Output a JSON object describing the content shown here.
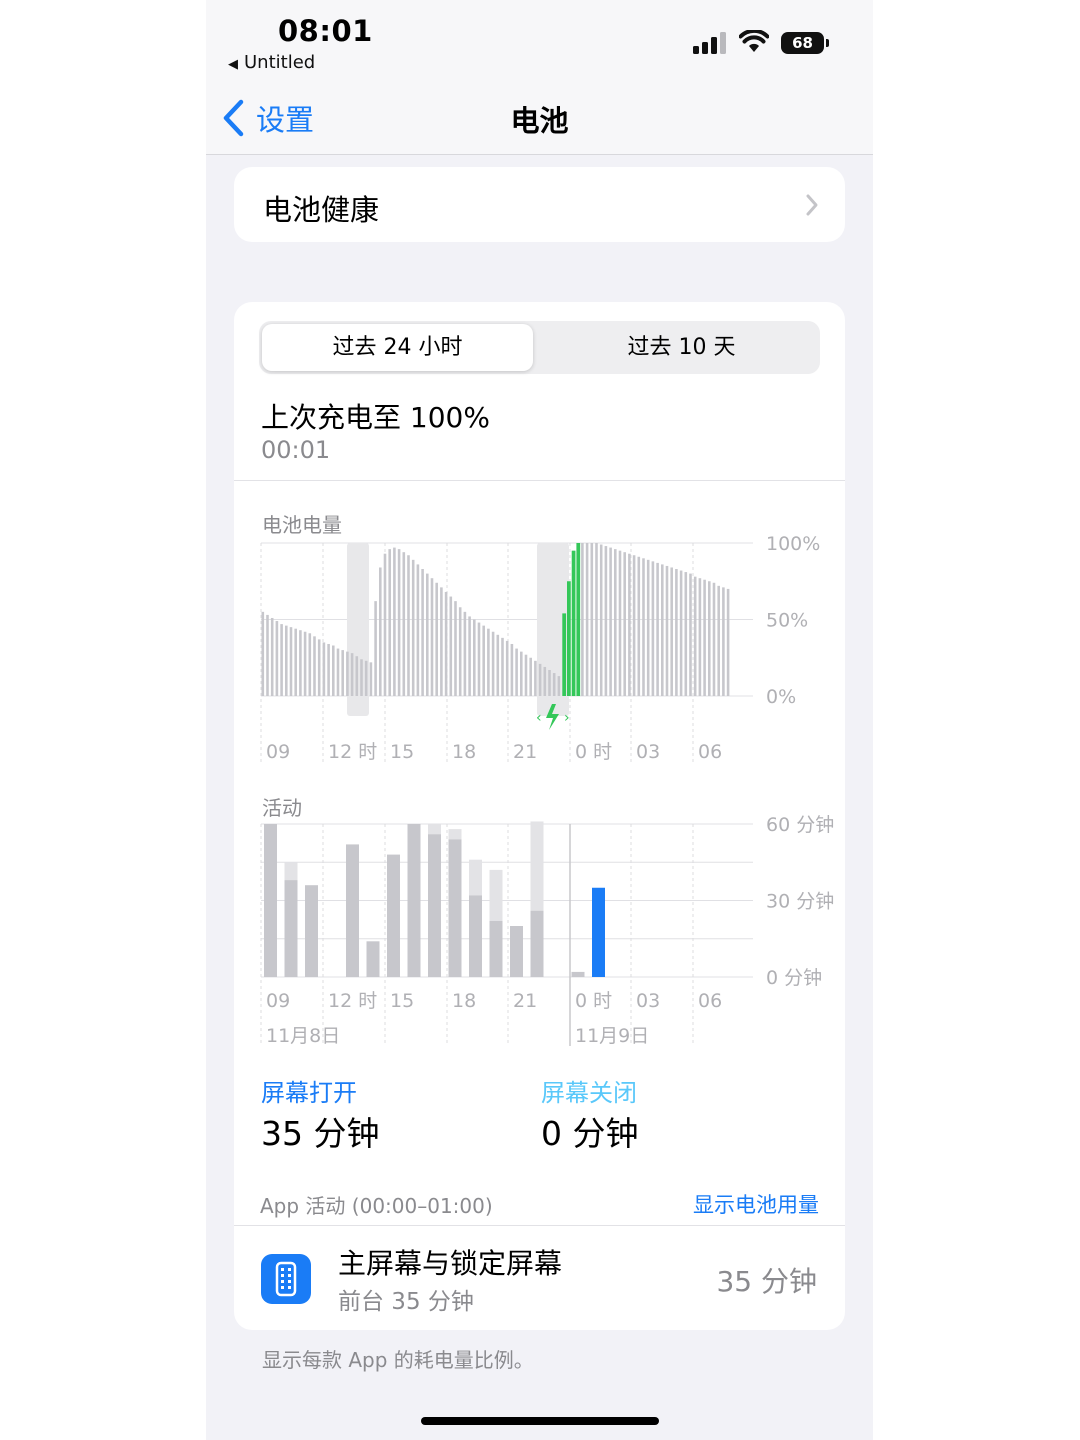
{
  "status_bar": {
    "time": "08:01",
    "back_app": "Untitled",
    "battery_level": "68"
  },
  "nav": {
    "back_label": "设置",
    "title": "电池"
  },
  "battery_health": {
    "label": "电池健康"
  },
  "segments": {
    "active": "过去 24 小时",
    "idle": "过去 10 天"
  },
  "last_charge": {
    "label": "上次充电至 100%",
    "time": "00:01"
  },
  "battery_chart_label": "电池电量",
  "activity_chart_label": "活动",
  "screen_on": {
    "label": "屏幕打开",
    "value": "35 分钟"
  },
  "screen_off": {
    "label": "屏幕关闭",
    "value": "0 分钟"
  },
  "app_activity": {
    "header": "App 活动 (00:00–01:00)",
    "show_usage": "显示电池用量",
    "row": {
      "name": "主屏幕与锁定屏幕",
      "sub": "前台 35 分钟",
      "time": "35 分钟"
    }
  },
  "footnote": "显示每款 App 的耗电量比例。",
  "colors": {
    "accent": "#1a7cf6",
    "charging_green": "#34c759",
    "bar_gray": "#c7c7cc",
    "bar_light": "#e3e3e6"
  },
  "chart_data": [
    {
      "type": "bar",
      "title": "电池电量",
      "x_tick_labels": [
        "09",
        "12 时",
        "15",
        "18",
        "21",
        "0 时",
        "03",
        "06"
      ],
      "y_tick_labels": [
        "100%",
        "50%",
        "0%"
      ],
      "ylim": [
        0,
        100
      ],
      "battery_percent": [
        55,
        53,
        51,
        49,
        47,
        46,
        45,
        44,
        43,
        42,
        41,
        39,
        37,
        35,
        34,
        33,
        31,
        30,
        29,
        28,
        26,
        24,
        23,
        22,
        62,
        84,
        93,
        96,
        97,
        96,
        94,
        92,
        89,
        86,
        83,
        80,
        77,
        74,
        71,
        68,
        65,
        62,
        58,
        55,
        52,
        50,
        48,
        46,
        44,
        42,
        40,
        38,
        36,
        34,
        31,
        29,
        27,
        25,
        23,
        21,
        19,
        17,
        15,
        13,
        54,
        75,
        95,
        100,
        100,
        100,
        100,
        100,
        99,
        98,
        97,
        96,
        95,
        94,
        93,
        92,
        91,
        90,
        89,
        88,
        87,
        86,
        85,
        84,
        83,
        82,
        81,
        80,
        78,
        77,
        76,
        75,
        74,
        72,
        71,
        70
      ],
      "charging_ranges": [
        "12 时",
        "23–0 时"
      ],
      "full_charge_highlight": "0 时",
      "grid": true
    },
    {
      "type": "bar",
      "title": "活动",
      "x_tick_labels": [
        "09",
        "12 时",
        "15",
        "18",
        "21",
        "0 时",
        "03",
        "06"
      ],
      "date_labels": [
        "11月8日",
        "11月9日"
      ],
      "y_tick_labels": [
        "60 分钟",
        "30 分钟",
        "0 分钟"
      ],
      "ylim": [
        0,
        60
      ],
      "unit": "分钟",
      "series": [
        {
          "name": "屏幕打开",
          "values": [
            60,
            38,
            36,
            0,
            52,
            14,
            48,
            60,
            56,
            54,
            32,
            22,
            20,
            26,
            0,
            2,
            35,
            0,
            0,
            0,
            0,
            0,
            0,
            0,
            0
          ]
        },
        {
          "name": "屏幕关闭",
          "values": [
            0,
            7,
            0,
            0,
            0,
            0,
            0,
            0,
            4,
            4,
            14,
            20,
            0,
            35,
            0,
            0,
            0,
            0,
            0,
            0,
            0,
            0,
            0,
            0,
            0
          ]
        }
      ],
      "highlighted_bar": 16,
      "grid": true
    }
  ]
}
